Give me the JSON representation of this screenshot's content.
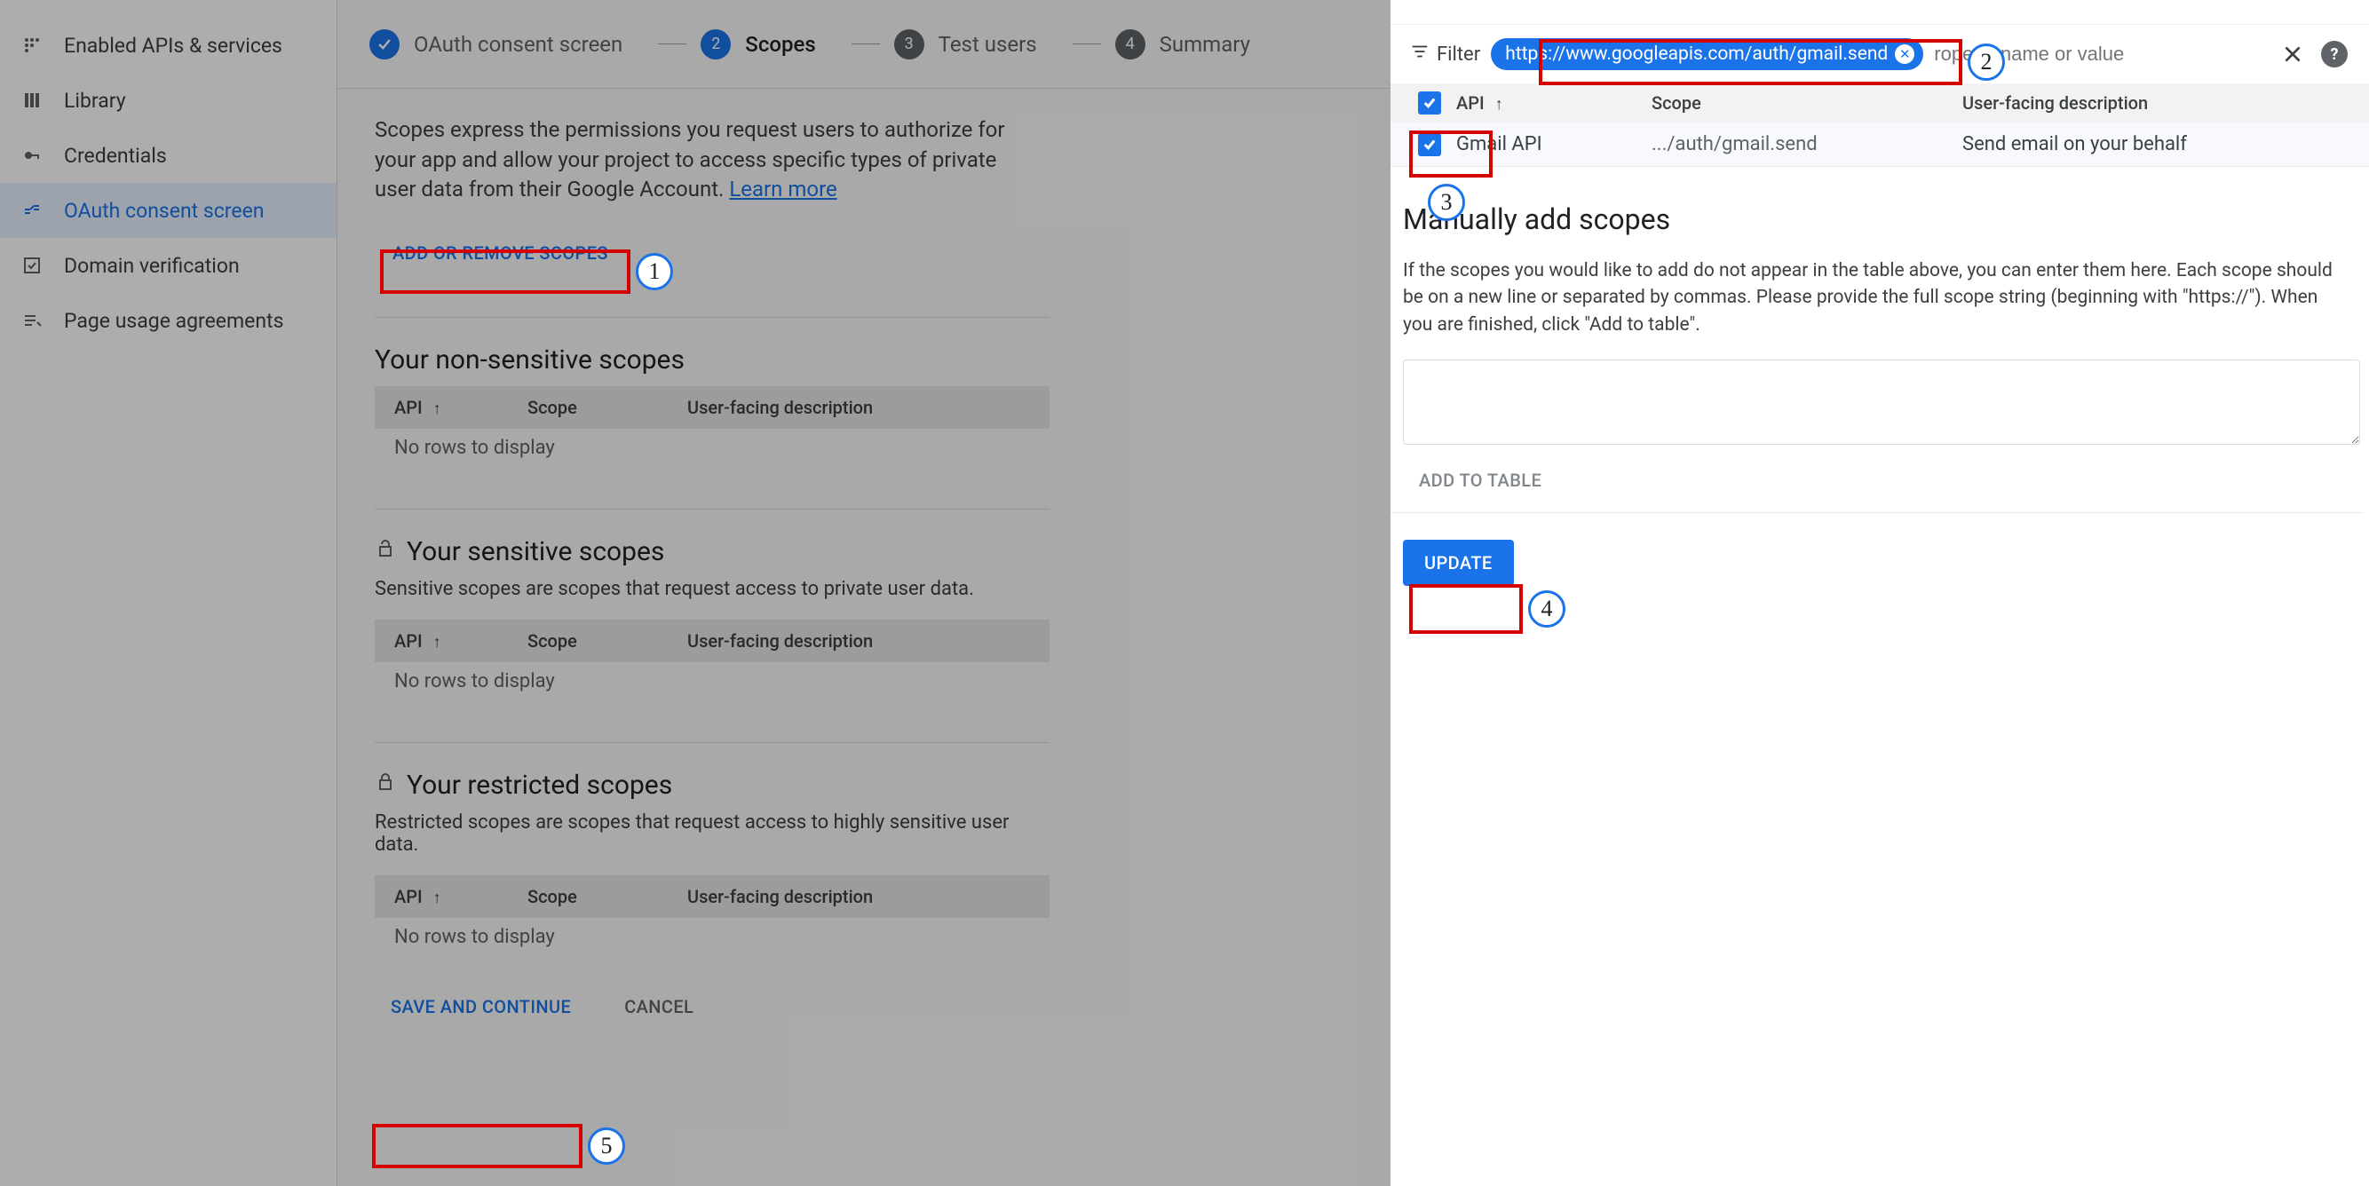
{
  "sidebar": {
    "items": [
      {
        "label": "Enabled APIs & services"
      },
      {
        "label": "Library"
      },
      {
        "label": "Credentials"
      },
      {
        "label": "OAuth consent screen"
      },
      {
        "label": "Domain verification"
      },
      {
        "label": "Page usage agreements"
      }
    ]
  },
  "stepper": {
    "step1": "OAuth consent screen",
    "step2": "Scopes",
    "step3": "Test users",
    "step4": "Summary"
  },
  "scopes": {
    "description_pre": "Scopes express the permissions you request users to authorize for your app and allow your project to access specific types of private user data from their Google Account. ",
    "learn_more": "Learn more",
    "add_remove_btn": "ADD OR REMOVE SCOPES",
    "section_nonsens_title": "Your non-sensitive scopes",
    "section_sens_title": "Your sensitive scopes",
    "section_sens_sub": "Sensitive scopes are scopes that request access to private user data.",
    "section_restr_title": "Your restricted scopes",
    "section_restr_sub": "Restricted scopes are scopes that request access to highly sensitive user data.",
    "table_head_api": "API",
    "table_head_scope": "Scope",
    "table_head_desc": "User-facing description",
    "no_rows": "No rows to display",
    "save_continue": "SAVE AND CONTINUE",
    "cancel": "CANCEL"
  },
  "panel": {
    "filter_label": "Filter",
    "filter_chip": "https://www.googleapis.com/auth/gmail.send",
    "filter_placeholder": "roperty name or value",
    "head_api": "API",
    "head_scope": "Scope",
    "head_desc": "User-facing description",
    "rows": [
      {
        "api": "Gmail API",
        "scope": ".../auth/gmail.send",
        "desc": "Send email on your behalf"
      }
    ],
    "manual_title": "Manually add scopes",
    "manual_desc": "If the scopes you would like to add do not appear in the table above, you can enter them here. Each scope should be on a new line or separated by commas. Please provide the full scope string (beginning with \"https://\"). When you are finished, click \"Add to table\".",
    "add_to_table": "ADD TO TABLE",
    "update": "UPDATE"
  },
  "annotations": {
    "n1": "1",
    "n2": "2",
    "n3": "3",
    "n4": "4",
    "n5": "5"
  }
}
